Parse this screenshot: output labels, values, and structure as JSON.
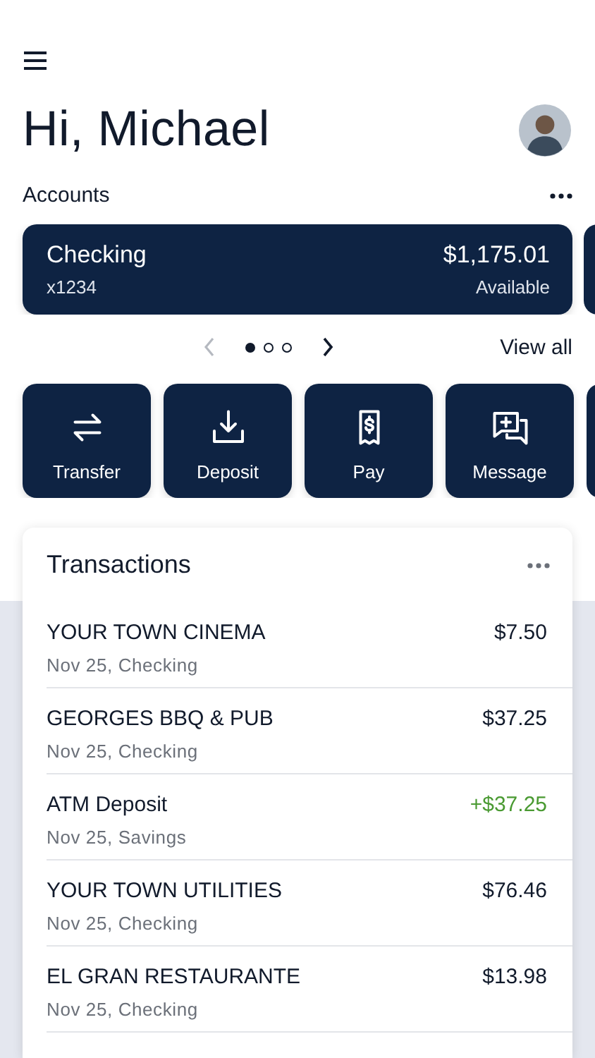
{
  "greeting": "Hi, Michael",
  "accounts": {
    "title": "Accounts",
    "view_all": "View all",
    "cards": [
      {
        "name": "Checking",
        "number": "x1234",
        "balance": "$1,175.01",
        "balance_label": "Available"
      }
    ],
    "dots": [
      {
        "selected": true
      },
      {
        "selected": false
      },
      {
        "selected": false
      }
    ]
  },
  "actions": [
    {
      "kind": "transfer",
      "label": "Transfer"
    },
    {
      "kind": "deposit",
      "label": "Deposit"
    },
    {
      "kind": "pay",
      "label": "Pay"
    },
    {
      "kind": "message",
      "label": "Message"
    }
  ],
  "transactions": {
    "title": "Transactions",
    "rows": [
      {
        "name": "YOUR TOWN CINEMA",
        "detail": "Nov 25, Checking",
        "amount": "$7.50",
        "kind": "debit"
      },
      {
        "name": "GEORGES BBQ & PUB",
        "detail": "Nov 25, Checking",
        "amount": "$37.25",
        "kind": "debit"
      },
      {
        "name": "ATM Deposit",
        "detail": "Nov 25, Savings",
        "amount": "+$37.25",
        "kind": "credit"
      },
      {
        "name": "YOUR TOWN UTILITIES",
        "detail": "Nov 25, Checking",
        "amount": "$76.46",
        "kind": "debit"
      },
      {
        "name": "EL GRAN RESTAURANTE",
        "detail": "Nov 25, Checking",
        "amount": "$13.98",
        "kind": "debit"
      }
    ]
  }
}
